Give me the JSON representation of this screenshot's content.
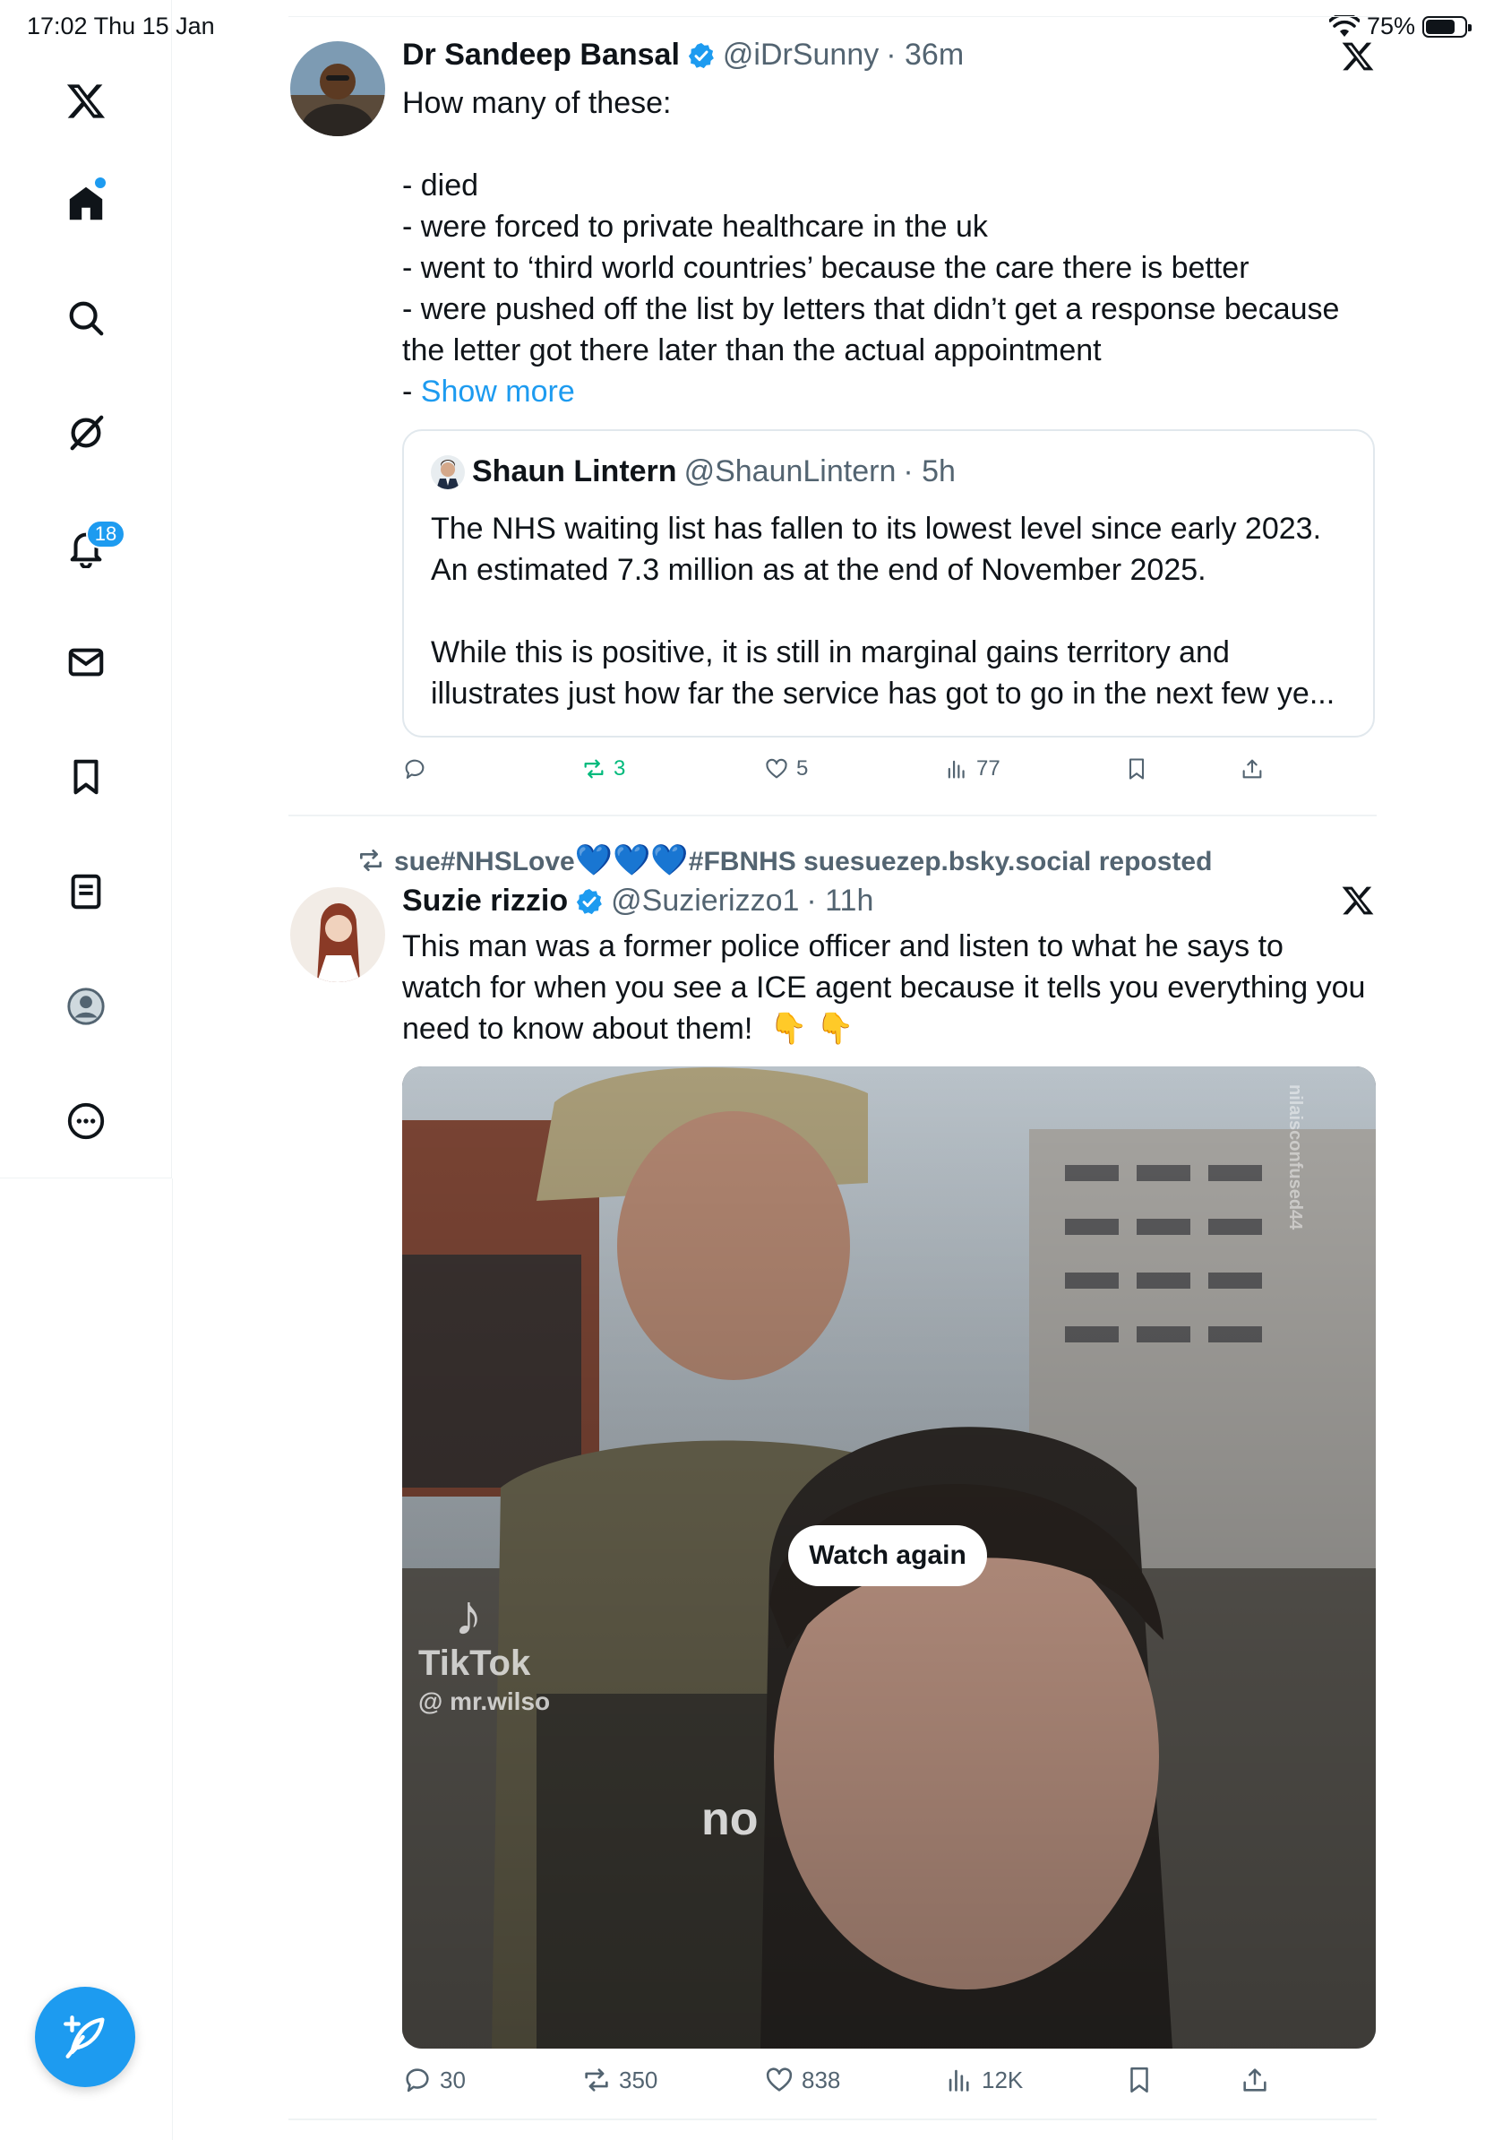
{
  "status_bar": {
    "time_date": "17:02  Thu 15 Jan",
    "battery": "75%",
    "battery_level": 0.75
  },
  "sidebar": {
    "items": [
      {
        "name": "x-logo-icon"
      },
      {
        "name": "home-icon",
        "has_dot": true
      },
      {
        "name": "search-icon"
      },
      {
        "name": "grok-icon"
      },
      {
        "name": "notifications-icon",
        "badge": "18"
      },
      {
        "name": "messages-icon"
      },
      {
        "name": "bookmarks-icon"
      },
      {
        "name": "lists-icon"
      },
      {
        "name": "profile-icon"
      },
      {
        "name": "more-icon"
      }
    ],
    "compose_icon": "compose-icon"
  },
  "tweet1": {
    "name": "Dr Sandeep Bansal",
    "handle": "@iDrSunny",
    "time": "· 36m",
    "text": "How many of these:\n\n- died\n- were forced to private healthcare in the uk\n- went to ‘third world countries’ because the care there is better\n- were pushed off the list by letters that didn’t get a response because\nthe letter got there later than the actual appointment\n- ",
    "show_more": "Show more",
    "quote": {
      "name": "Shaun Lintern",
      "handle": "@ShaunLintern",
      "time": "· 5h",
      "text": "The NHS waiting list has fallen to its lowest level since early 2023.\nAn estimated 7.3 million as at the end of November 2025.\n\nWhile this is positive, it is still in marginal gains territory and\nillustrates just how far the service has got to go in the next few ye..."
    },
    "actions": {
      "replies": "",
      "reposts": "3",
      "likes": "5",
      "views": "77"
    }
  },
  "tweet2": {
    "reposted_by_prefix": "sue#NHSLove",
    "reposted_by_hearts": "💙💙💙",
    "reposted_by_suffix": "#FBNHS suesuezep.bsky.social reposted",
    "name": "Suzie rizzio",
    "handle": "@Suzierizzo1",
    "time": "· 11h",
    "text": "This man was a former police officer and listen to what he says to\nwatch for when you see a ICE agent because it tells you everything you\nneed to know about them!  👇 👇",
    "media": {
      "watch_again": "Watch again",
      "watermark_brand": "TikTok",
      "watermark_user": "@ mr.wilso",
      "overlay_word": "no",
      "side_watermark": "nilaisconfused44"
    },
    "actions": {
      "replies": "30",
      "reposts": "350",
      "likes": "838",
      "views": "12K"
    }
  },
  "colors": {
    "accent": "#1d9bf0",
    "text": "#0f1419",
    "secondary": "#536471",
    "repost_green": "#00ba7c",
    "border": "#eff3f4"
  }
}
